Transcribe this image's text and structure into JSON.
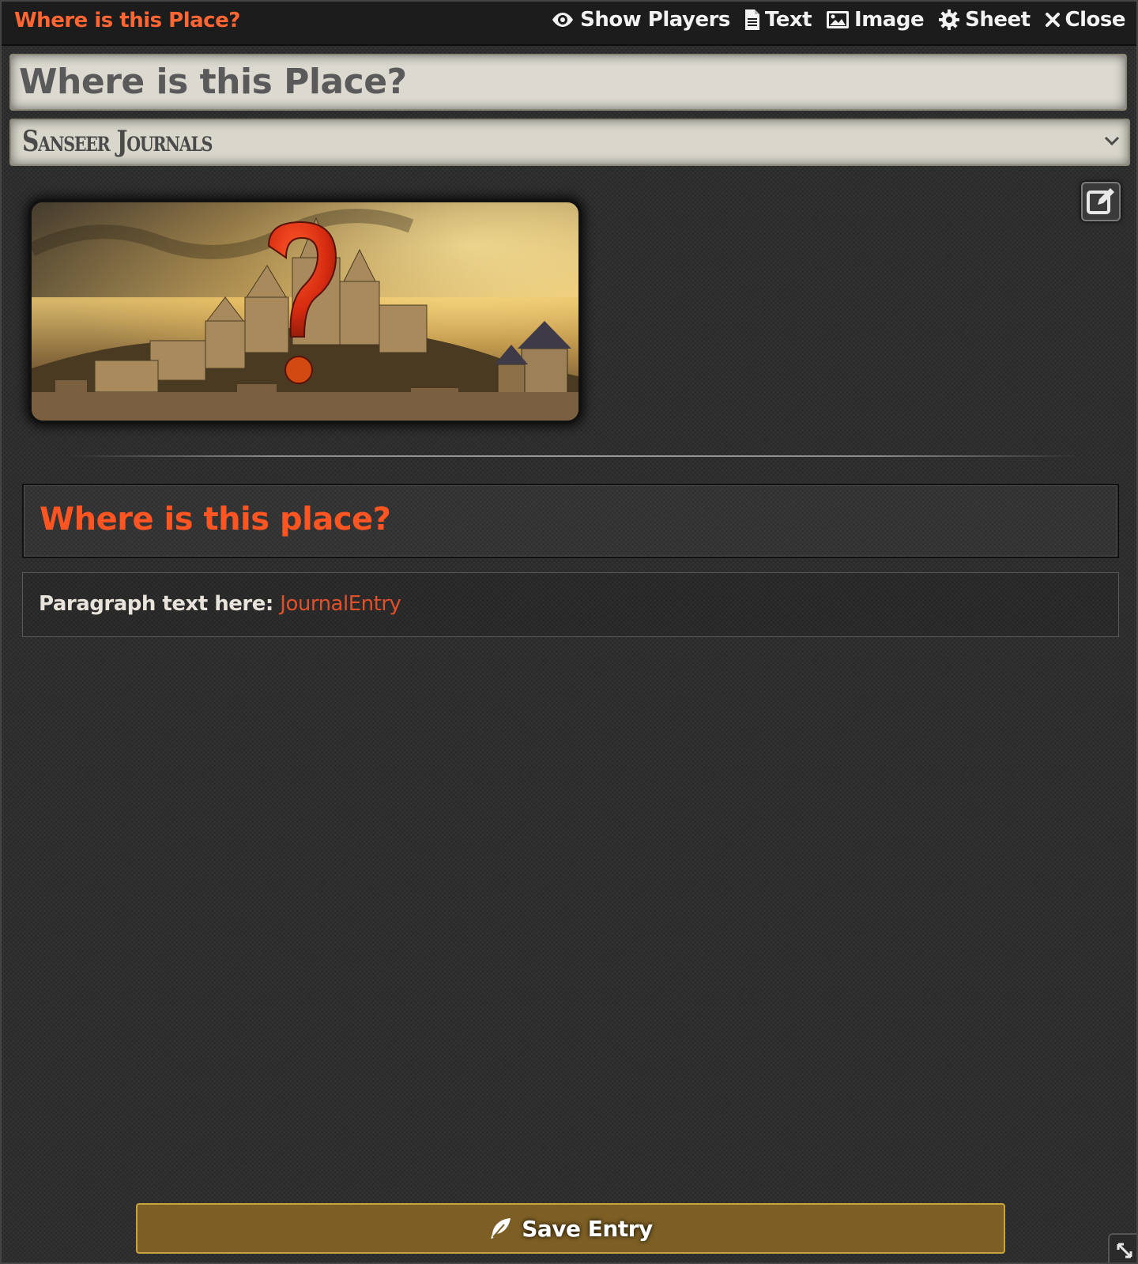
{
  "window": {
    "title": "Where is this Place?",
    "controls": [
      {
        "label": "Show Players",
        "icon": "eye-icon"
      },
      {
        "label": "Text",
        "icon": "file-text-icon"
      },
      {
        "label": "Image",
        "icon": "image-icon"
      },
      {
        "label": "Sheet",
        "icon": "gear-icon"
      },
      {
        "label": "Close",
        "icon": "close-icon"
      }
    ]
  },
  "entry": {
    "name_value": "Where is this Place?",
    "sheet_value": "Sanseer Journals"
  },
  "content": {
    "heading": "Where is this place?",
    "paragraph_label": "Paragraph text here:",
    "paragraph_link": "JournalEntry"
  },
  "footer": {
    "save_label": "Save Entry"
  },
  "colors": {
    "title_accent": "#ff6633",
    "heading": "#ff5522",
    "save_button": "#7d5f25"
  }
}
